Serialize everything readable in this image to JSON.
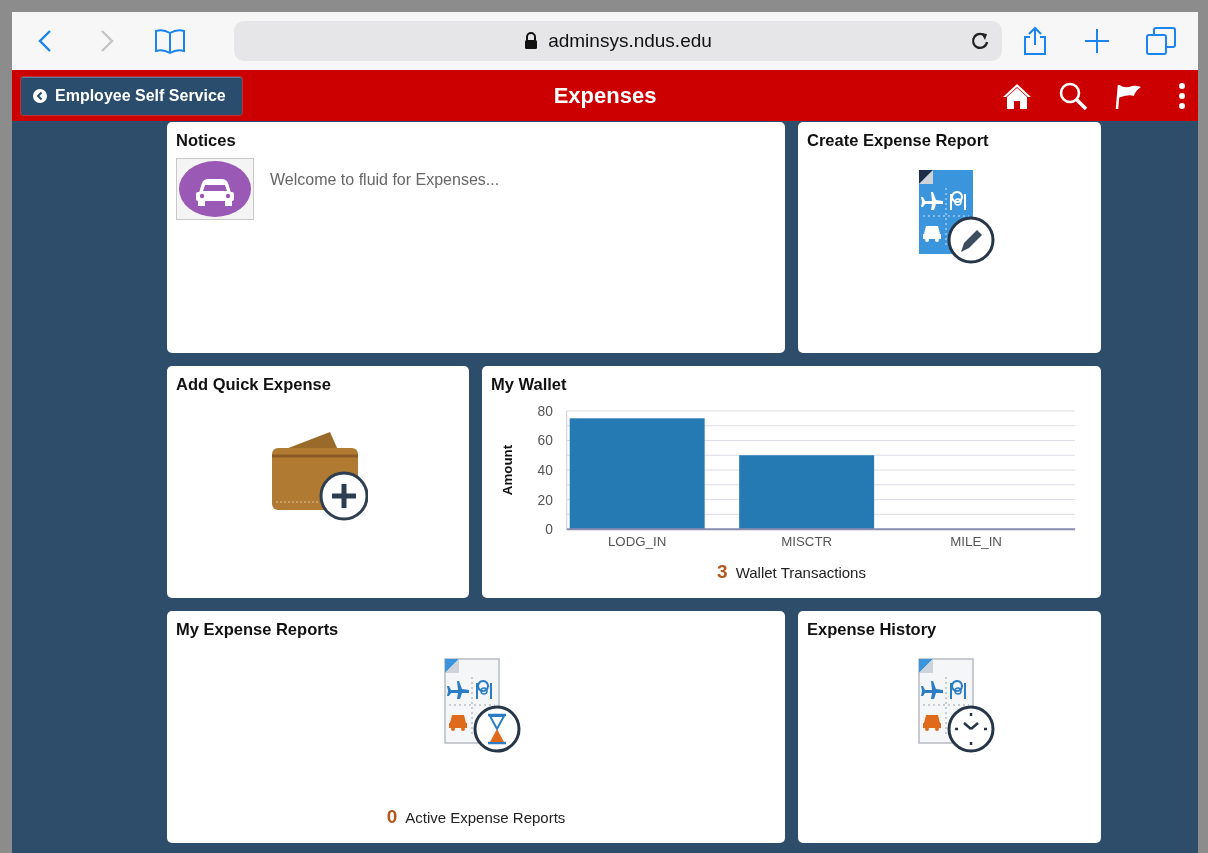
{
  "browser": {
    "url": "adminsys.ndus.edu"
  },
  "header": {
    "back_button": "Employee Self Service",
    "title": "Expenses"
  },
  "tiles": [
    {
      "kind": "notices",
      "title": "Notices",
      "message": "Welcome to fluid for Expenses..."
    },
    {
      "kind": "create_report",
      "title": "Create Expense Report"
    },
    {
      "kind": "quick_expense",
      "title": "Add Quick Expense"
    },
    {
      "kind": "wallet",
      "title": "My Wallet",
      "count": "3",
      "count_label": "Wallet Transactions",
      "chart_data": {
        "type": "bar",
        "ylabel": "Amount",
        "categories": [
          "LODG_IN",
          "MISCTR",
          "MILE_IN"
        ],
        "values": [
          75,
          50,
          0
        ],
        "ylim": [
          0,
          80
        ],
        "grid": true,
        "yticks": [
          0,
          20,
          40,
          60,
          80
        ]
      }
    },
    {
      "kind": "my_reports",
      "title": "My Expense Reports",
      "count": "0",
      "count_label": "Active Expense Reports"
    },
    {
      "kind": "history",
      "title": "Expense History"
    }
  ]
}
